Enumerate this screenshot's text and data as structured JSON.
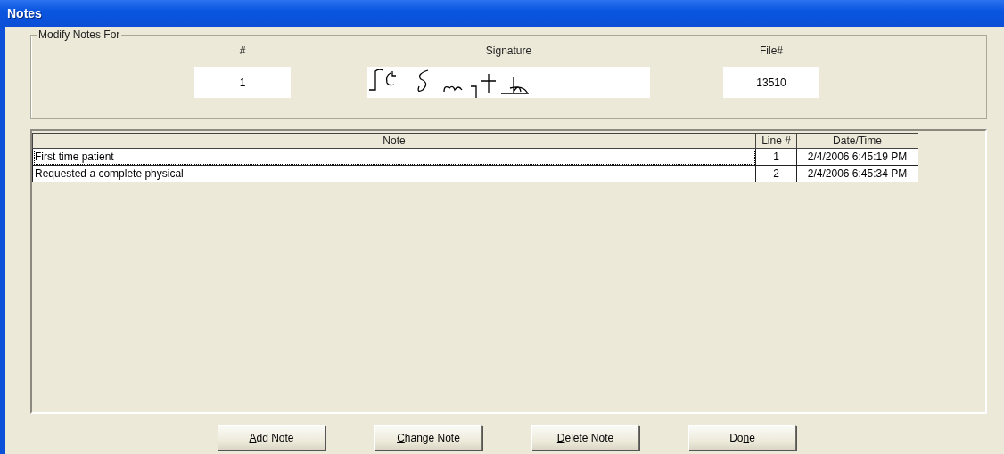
{
  "window": {
    "title": "Notes"
  },
  "modify_group": {
    "title": "Modify Notes For",
    "fields": [
      {
        "kind": "text",
        "label": "#",
        "value": "1"
      },
      {
        "kind": "signature",
        "label": "Signature"
      },
      {
        "kind": "text",
        "label": "File#",
        "value": "13510"
      }
    ]
  },
  "table": {
    "columns": [
      "Note",
      "Line #",
      "Date/Time"
    ],
    "rows": [
      {
        "note": "First time patient",
        "line": "1",
        "datetime": "2/4/2006 6:45:19 PM",
        "selected": true
      },
      {
        "note": "Requested a complete physical",
        "line": "2",
        "datetime": "2/4/2006 6:45:34 PM",
        "selected": false
      }
    ]
  },
  "buttons": [
    {
      "access_key": "A",
      "after": "dd Note"
    },
    {
      "access_key": "C",
      "after": "hange Note"
    },
    {
      "access_key": "D",
      "after": "elete Note"
    },
    {
      "before": "Do",
      "access_key": "n",
      "after": "e"
    }
  ]
}
